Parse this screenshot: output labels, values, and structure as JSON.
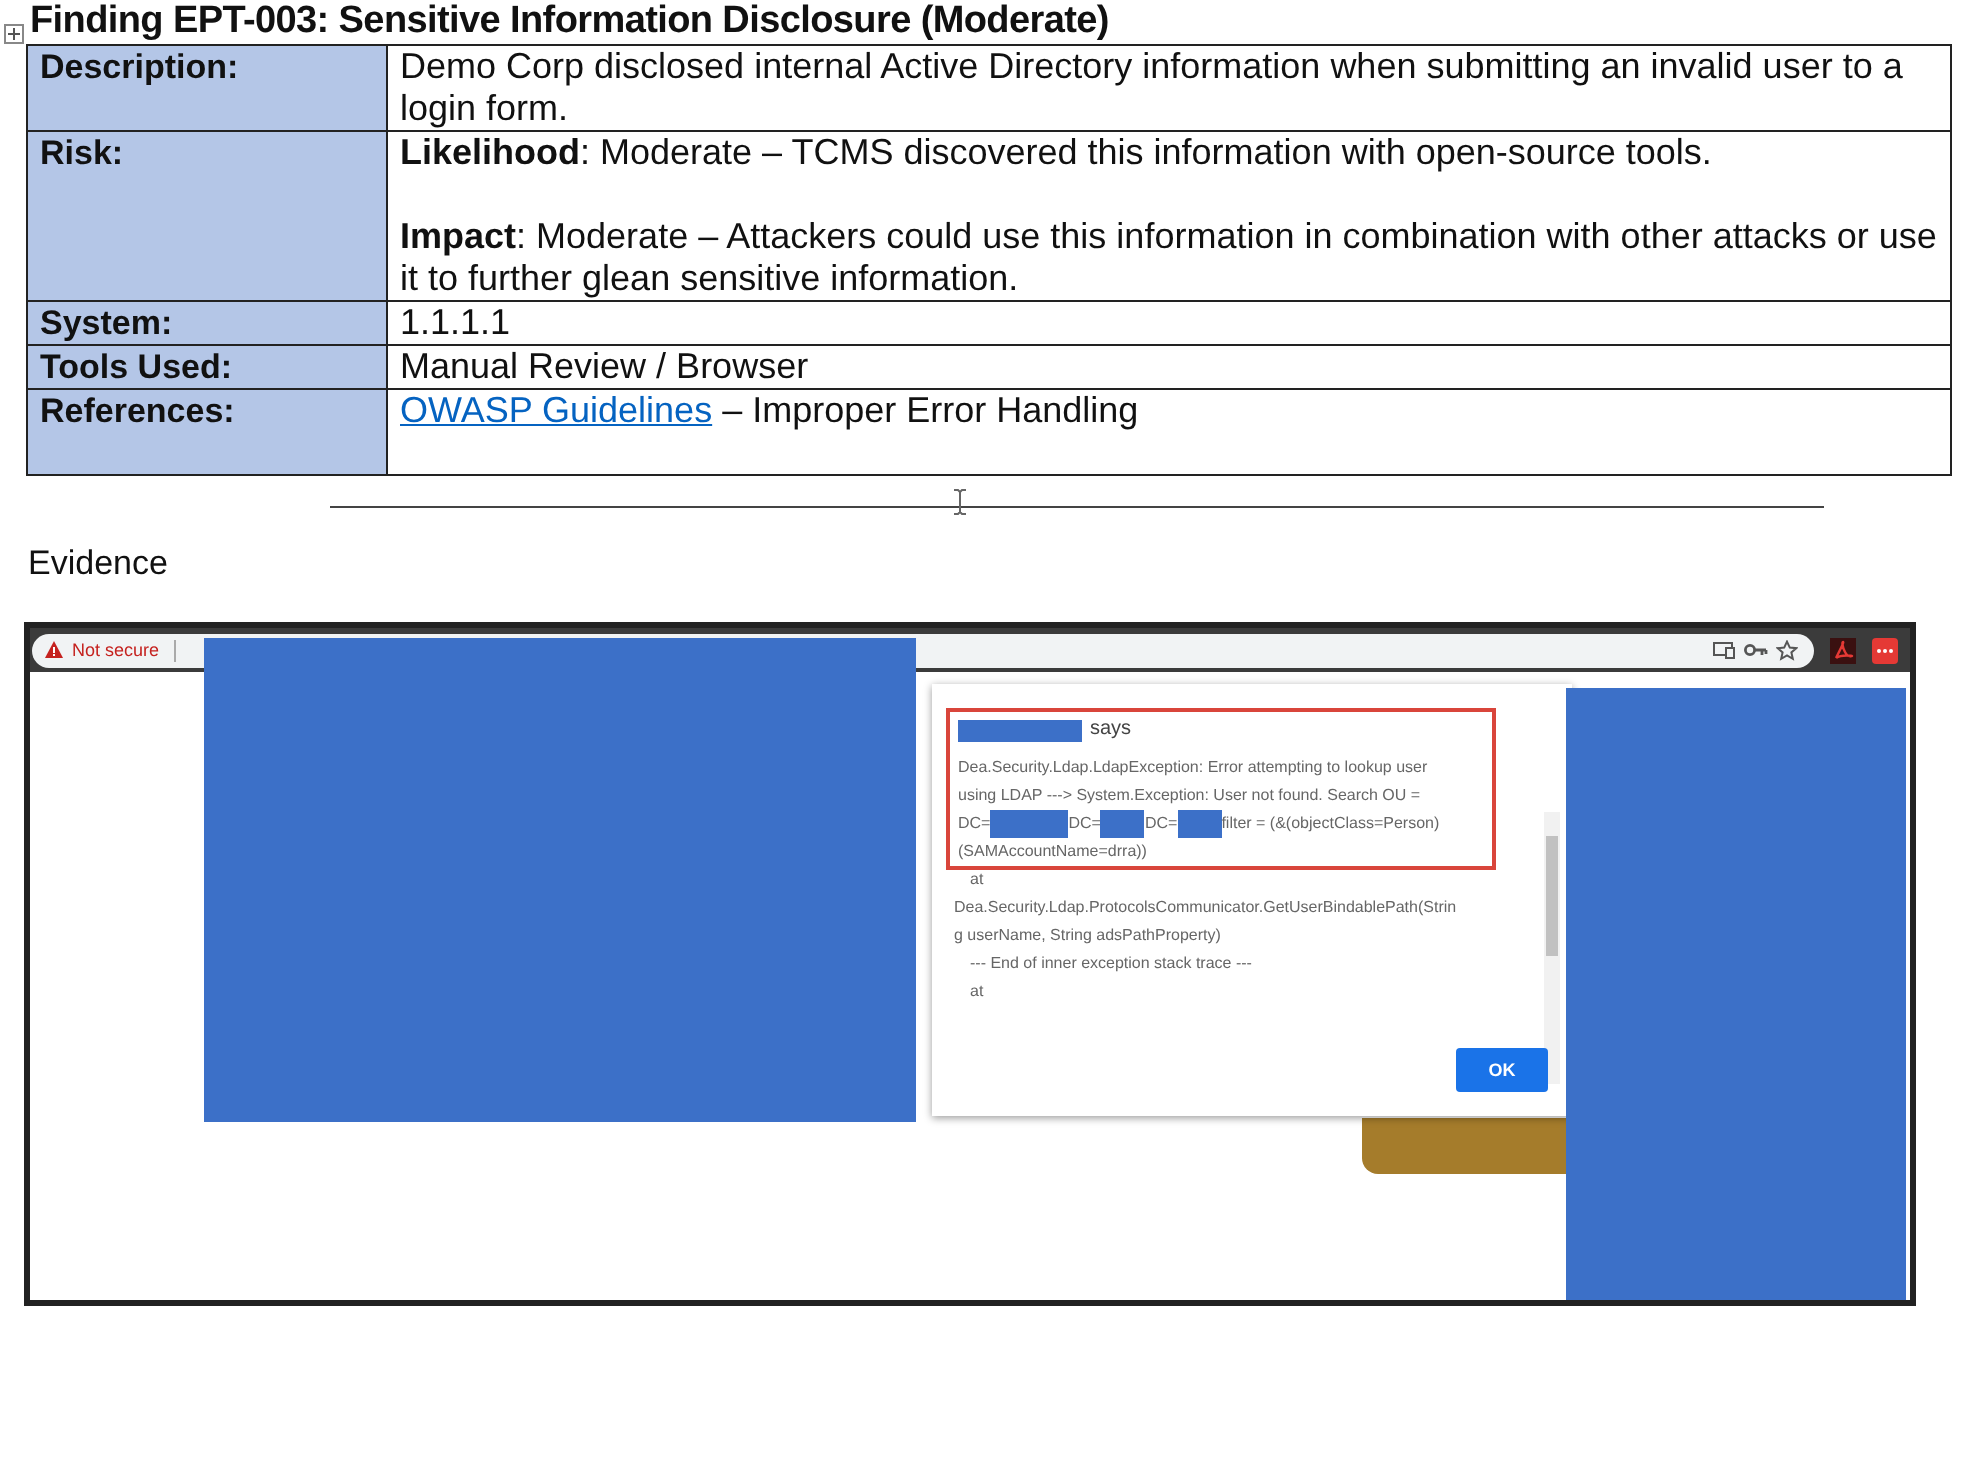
{
  "finding_title": "Finding EPT-003: Sensitive Information Disclosure (Moderate)",
  "table": {
    "rows": [
      {
        "kind": "text",
        "label": "Description:",
        "paragraphs": [
          "Demo Corp disclosed internal Active Directory information when submitting an invalid user to a login form."
        ]
      },
      {
        "kind": "text",
        "label": "Risk:",
        "paragraphs": [
          "**Likelihood**: Moderate – TCMS discovered this information with open-source tools.",
          "**Impact**: Moderate – Attackers could use this information in combination with other attacks or use it to further glean sensitive information."
        ]
      },
      {
        "kind": "text",
        "label": "System:",
        "paragraphs": [
          "1.1.1.1"
        ]
      },
      {
        "kind": "text",
        "label": "Tools Used:",
        "paragraphs": [
          "Manual Review / Browser"
        ]
      },
      {
        "kind": "reference",
        "label": "References:",
        "link": "OWASP Guidelines",
        "text": " – Improper Error Handling"
      }
    ]
  },
  "evidence_heading": "Evidence",
  "screenshot": {
    "security_label": "Not secure",
    "dialog": {
      "title": "says",
      "message_lines": [
        "Dea.Security.Ldap.LdapException: Error attempting to lookup user",
        "using LDAP ---> System.Exception: User not found. Search OU ="
      ],
      "redacted_line": [
        "DC=",
        "DC=",
        "DC=",
        "filter = (&(objectClass=Person)"
      ],
      "message_end": "(SAMAccountName=drra))",
      "stack_lines": [
        "at",
        "Dea.Security.Ldap.ProtocolsCommunicator.GetUserBindablePath(Strin",
        "g userName, String adsPathProperty)",
        "--- End of inner exception stack trace ---",
        "at"
      ],
      "button": "OK"
    }
  }
}
